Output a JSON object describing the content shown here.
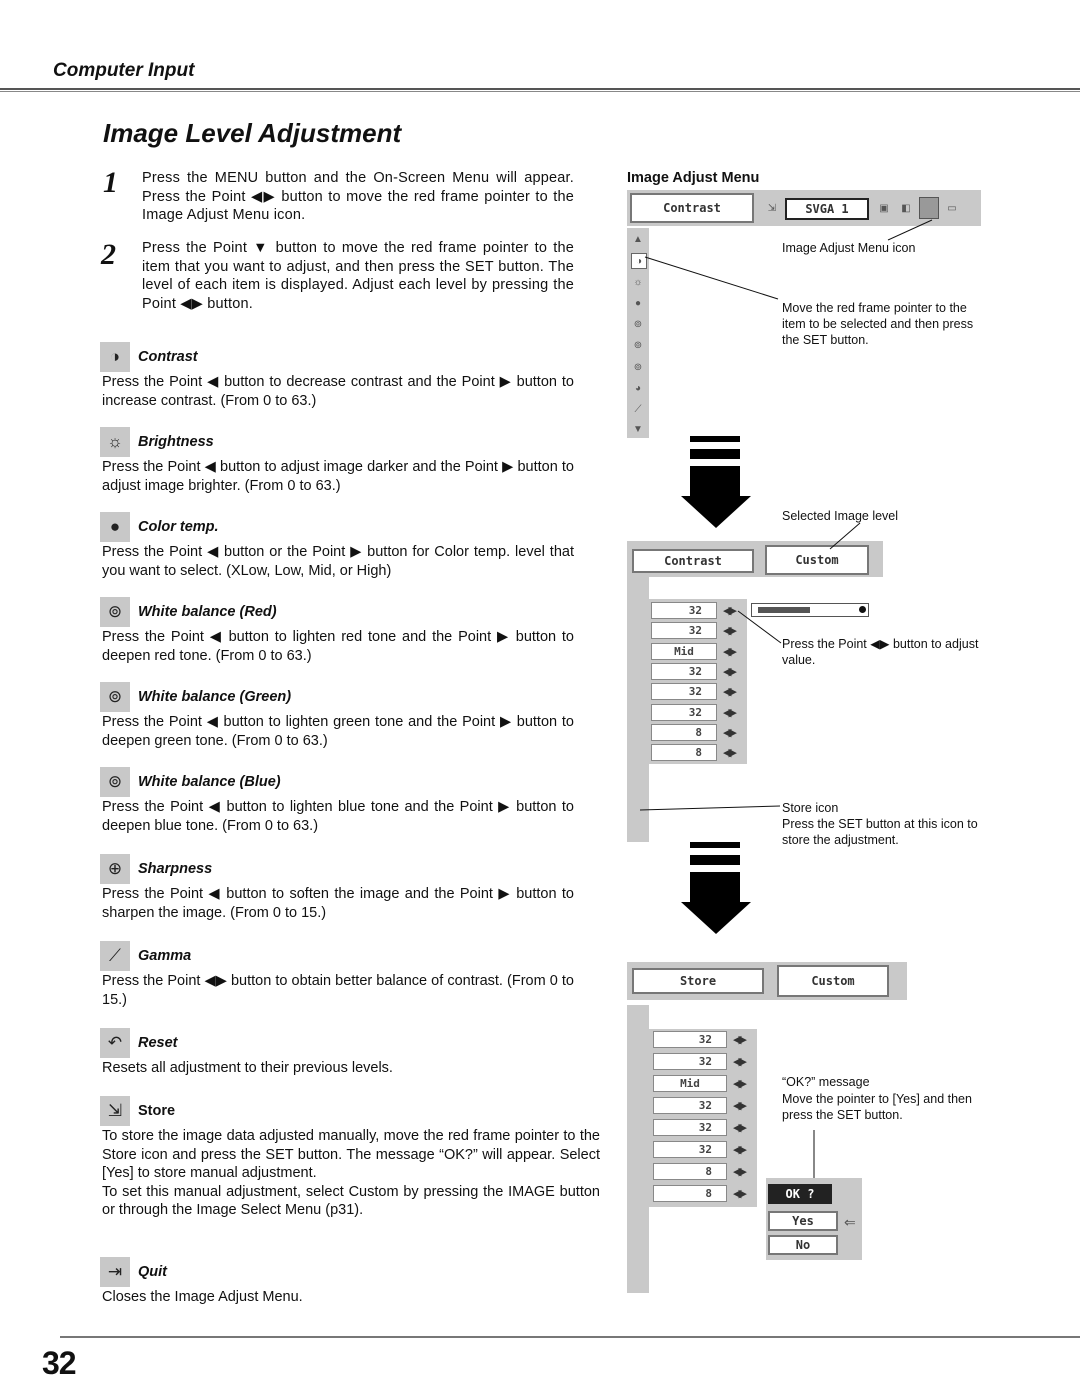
{
  "header": {
    "section": "Computer Input",
    "title": "Image Level Adjustment"
  },
  "steps": [
    {
      "num": "1",
      "text": "Press the MENU button and the On-Screen Menu will appear.  Press the Point ◀▶ button to move the red frame pointer to the Image Adjust Menu icon."
    },
    {
      "num": "2",
      "text": "Press the Point ▼ button to move the red frame pointer to the item that you want to adjust, and then press the SET button.  The level of each item is displayed.  Adjust each level by pressing the Point ◀▶ button."
    }
  ],
  "items": [
    {
      "icon": "contrast-icon",
      "glyph": "◑",
      "title": "Contrast",
      "desc": "Press the Point ◀ button to decrease contrast and the Point ▶ button to increase contrast.  (From 0 to 63.)"
    },
    {
      "icon": "brightness-icon",
      "glyph": "☼",
      "title": "Brightness",
      "desc": "Press the Point ◀ button to adjust image darker and the Point ▶ button to adjust image brighter.  (From 0 to 63.)"
    },
    {
      "icon": "color-temp-icon",
      "glyph": "●",
      "title": "Color temp.",
      "desc": "Press the Point ◀ button or the Point ▶ button for Color temp. level that you want to select. (XLow, Low, Mid, or High)"
    },
    {
      "icon": "white-balance-red-icon",
      "glyph": "⊚",
      "title": "White balance (Red)",
      "desc": "Press the Point ◀ button to lighten red tone and the Point ▶ button to deepen red tone.  (From 0 to 63.)"
    },
    {
      "icon": "white-balance-green-icon",
      "glyph": "⊚",
      "title": "White balance (Green)",
      "desc": "Press the Point ◀ button to lighten green tone and the Point ▶ button to deepen green tone.  (From 0 to 63.)"
    },
    {
      "icon": "white-balance-blue-icon",
      "glyph": "⊚",
      "title": "White balance (Blue)",
      "desc": "Press the Point ◀ button to lighten blue tone and the Point ▶ button to deepen blue tone.  (From 0 to 63.)"
    },
    {
      "icon": "sharpness-icon",
      "glyph": "⊕",
      "title": "Sharpness",
      "desc": "Press the Point ◀ button to soften the image and the Point ▶ button to sharpen the image.  (From 0 to 15.)"
    },
    {
      "icon": "gamma-icon",
      "glyph": "⟋",
      "title": "Gamma",
      "desc": "Press the Point ◀▶ button to obtain better balance of contrast.  (From 0 to 15.)"
    },
    {
      "icon": "reset-icon",
      "glyph": "↶",
      "title": "Reset",
      "desc": "Resets all adjustment to their previous levels."
    },
    {
      "icon": "store-icon",
      "glyph": "⇲",
      "title": "Store",
      "desc": "To store the image data adjusted manually, move the red frame pointer to the Store icon and press the SET button. The message “OK?” will appear.  Select [Yes] to store manual adjustment.\nTo set this manual adjustment, select Custom by pressing the IMAGE button or through the Image Select Menu (p31)."
    },
    {
      "icon": "quit-icon",
      "glyph": "⇥",
      "title": "Quit",
      "desc": "Closes the Image Adjust Menu."
    }
  ],
  "menu": {
    "label": "Image Adjust Menu",
    "screen1": {
      "field": "Contrast",
      "source": "SVGA 1"
    },
    "screen2": {
      "field": "Contrast",
      "level": "Custom",
      "contrast_bar_fraction": 0.5
    },
    "screen3": {
      "field": "Store",
      "level": "Custom",
      "ok_title": "OK ?",
      "yes": "Yes",
      "no": "No"
    },
    "values": [
      "32",
      "32",
      "Mid",
      "32",
      "32",
      "32",
      "8",
      "8"
    ],
    "notes": {
      "icon": "Image Adjust Menu icon",
      "move": "Move the red frame pointer to the item to be selected and then press the SET button.",
      "selected": "Selected Image level",
      "press": "Press the Point ◀▶ button to adjust value.",
      "store_title": "Store icon",
      "store": "Press the SET button at this icon to store the adjustment.",
      "ok_title": "“OK?”  message",
      "ok": "Move the pointer to [Yes] and then press the SET button."
    }
  },
  "footer": {
    "page": "32"
  }
}
